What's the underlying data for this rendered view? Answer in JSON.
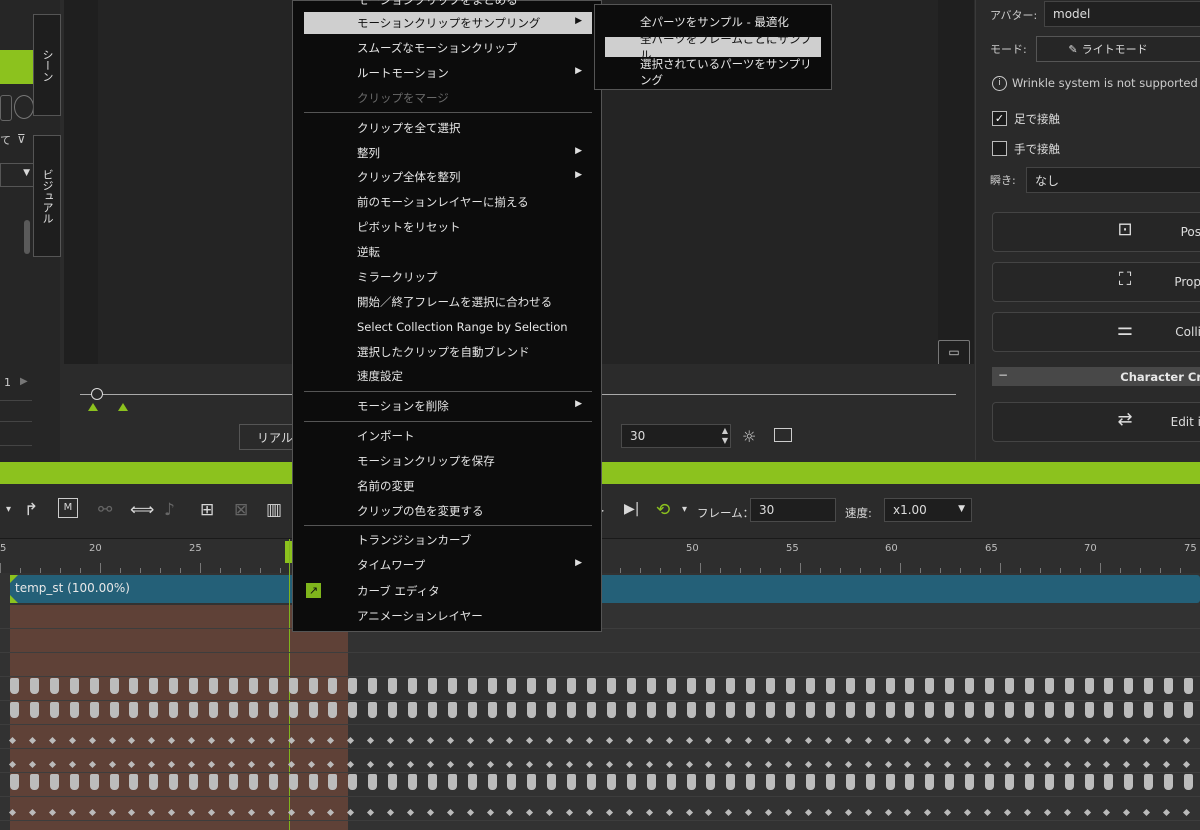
{
  "left_panel": {
    "tabs": [
      "シーン",
      "ビジュアル"
    ],
    "snippets": [
      "て",
      "1"
    ]
  },
  "viewport": {
    "playback_mode": "リアル",
    "frame_value": "30"
  },
  "right_panel": {
    "avatar_label": "アバター:",
    "avatar_value": "model",
    "mode_label": "モード:",
    "mode_value": "ライトモード",
    "wrinkle_notice": "Wrinkle system is not supported in",
    "foot_contact": "足で接触",
    "hand_contact": "手で接触",
    "blink_label": "瞬き:",
    "blink_value": "なし",
    "buttons": [
      "Pos",
      "Prop",
      "Colli"
    ],
    "section_header": "Character Cr",
    "edit_button": "Edit i",
    "foot_contact_checked": true,
    "hand_contact_checked": false
  },
  "toolbar": {
    "frame_label": "フレーム：",
    "frame_value": "30",
    "speed_label": "速度:",
    "speed_value": "x1.00"
  },
  "timeline": {
    "ruler_labels": [
      "5",
      "20",
      "25",
      "50",
      "55",
      "60",
      "65",
      "70",
      "75"
    ],
    "clip_label": "temp_st (100.00%)"
  },
  "context_menu": {
    "items": [
      {
        "label": "モーションクリップをまとめる",
        "submenu": false,
        "disabled": false
      },
      {
        "label": "モーションクリップをサンプリング",
        "submenu": true,
        "disabled": false,
        "highlighted": true
      },
      {
        "label": "スムーズなモーションクリップ",
        "submenu": false,
        "disabled": false
      },
      {
        "label": "ルートモーション",
        "submenu": true,
        "disabled": false
      },
      {
        "label": "クリップをマージ",
        "submenu": false,
        "disabled": true
      },
      {
        "label": "クリップを全て選択",
        "submenu": false,
        "disabled": false
      },
      {
        "label": "整列",
        "submenu": true,
        "disabled": false
      },
      {
        "label": "クリップ全体を整列",
        "submenu": true,
        "disabled": false
      },
      {
        "label": "前のモーションレイヤーに揃える",
        "submenu": false,
        "disabled": false
      },
      {
        "label": "ピボットをリセット",
        "submenu": false,
        "disabled": false
      },
      {
        "label": "逆転",
        "submenu": false,
        "disabled": false
      },
      {
        "label": "ミラークリップ",
        "submenu": false,
        "disabled": false
      },
      {
        "label": "開始／終了フレームを選択に合わせる",
        "submenu": false,
        "disabled": false
      },
      {
        "label": "Select Collection Range by Selection",
        "submenu": false,
        "disabled": false
      },
      {
        "label": "選択したクリップを自動ブレンド",
        "submenu": false,
        "disabled": false
      },
      {
        "label": "速度設定",
        "submenu": false,
        "disabled": false
      },
      {
        "label": "モーションを削除",
        "submenu": true,
        "disabled": false
      },
      {
        "label": "インポート",
        "submenu": false,
        "disabled": false
      },
      {
        "label": "モーションクリップを保存",
        "submenu": false,
        "disabled": false
      },
      {
        "label": "名前の変更",
        "submenu": false,
        "disabled": false
      },
      {
        "label": "クリップの色を変更する",
        "submenu": false,
        "disabled": false
      },
      {
        "label": "トランジションカーブ",
        "submenu": false,
        "disabled": false
      },
      {
        "label": "タイムワープ",
        "submenu": true,
        "disabled": false
      },
      {
        "label": "カーブ エディタ",
        "submenu": false,
        "disabled": false,
        "icon": "curve-editor-icon"
      },
      {
        "label": "アニメーションレイヤー",
        "submenu": false,
        "disabled": false
      }
    ]
  },
  "submenu": {
    "items": [
      {
        "label": "全パーツをサンプル - 最適化",
        "highlighted": false
      },
      {
        "label": "全パーツをフレームごとにサンプル",
        "highlighted": true
      },
      {
        "label": "選択されているパーツをサンプリング",
        "highlighted": false
      }
    ]
  },
  "colors": {
    "accent_green": "#8cc21e",
    "clip_blue": "#246078",
    "selection_brown": "#7a4c3c",
    "menu_bg": "#0c0c0c",
    "highlight": "#cfcfcf"
  }
}
